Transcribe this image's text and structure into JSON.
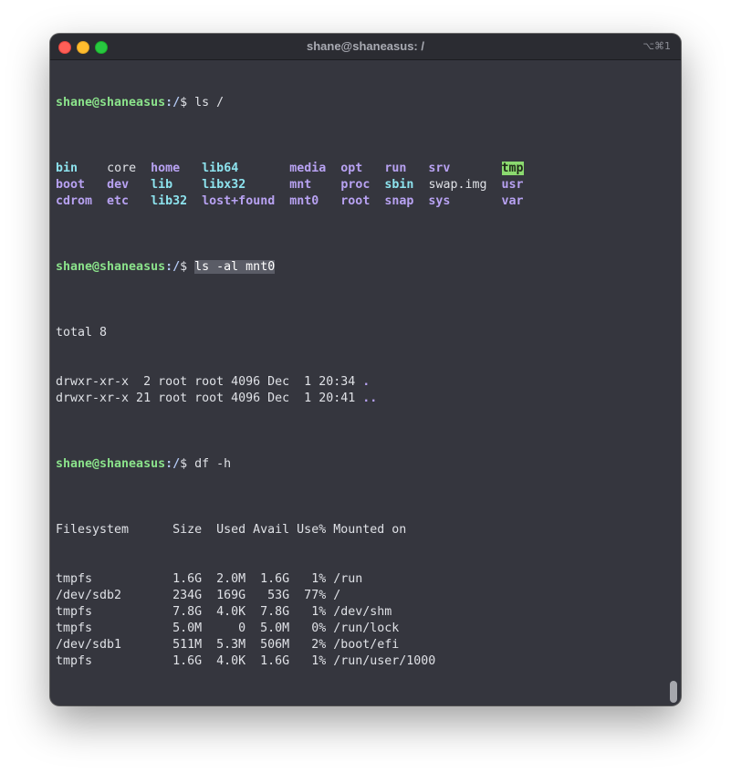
{
  "window": {
    "title": "shane@shaneasus: /",
    "shortcut": "⌥⌘1"
  },
  "prompt": {
    "user_host": "shane@shaneasus",
    "path": ":/",
    "symbol": "$"
  },
  "commands": {
    "ls": " ls /",
    "ls_al_space": " ",
    "ls_al": "ls -al mnt0",
    "df": " df -h"
  },
  "ls_output": {
    "rows": [
      [
        {
          "name": "bin",
          "kind": "link"
        },
        {
          "name": "core",
          "kind": "file"
        },
        {
          "name": "home",
          "kind": "dir"
        },
        {
          "name": "lib64",
          "kind": "link"
        },
        {
          "name": "media",
          "kind": "dir"
        },
        {
          "name": "opt",
          "kind": "dir"
        },
        {
          "name": "run",
          "kind": "dir"
        },
        {
          "name": "srv",
          "kind": "dir"
        },
        {
          "name": "tmp",
          "kind": "tmp"
        }
      ],
      [
        {
          "name": "boot",
          "kind": "dir"
        },
        {
          "name": "dev",
          "kind": "dir"
        },
        {
          "name": "lib",
          "kind": "link"
        },
        {
          "name": "libx32",
          "kind": "link"
        },
        {
          "name": "mnt",
          "kind": "dir"
        },
        {
          "name": "proc",
          "kind": "dir"
        },
        {
          "name": "sbin",
          "kind": "link"
        },
        {
          "name": "swap.img",
          "kind": "file"
        },
        {
          "name": "usr",
          "kind": "dir"
        }
      ],
      [
        {
          "name": "cdrom",
          "kind": "dir"
        },
        {
          "name": "etc",
          "kind": "dir"
        },
        {
          "name": "lib32",
          "kind": "link"
        },
        {
          "name": "lost+found",
          "kind": "dir"
        },
        {
          "name": "mnt0",
          "kind": "dir"
        },
        {
          "name": "root",
          "kind": "dir"
        },
        {
          "name": "snap",
          "kind": "dir"
        },
        {
          "name": "sys",
          "kind": "dir"
        },
        {
          "name": "var",
          "kind": "dir"
        }
      ]
    ]
  },
  "ls_al_output": {
    "total": "total 8",
    "rows": [
      {
        "meta": "drwxr-xr-x  2 root root 4096 Dec  1 20:34 ",
        "name": "."
      },
      {
        "meta": "drwxr-xr-x 21 root root 4096 Dec  1 20:41 ",
        "name": ".."
      }
    ]
  },
  "df_output": {
    "header": "Filesystem      Size  Used Avail Use% Mounted on",
    "rows": [
      "tmpfs           1.6G  2.0M  1.6G   1% /run",
      "/dev/sdb2       234G  169G   53G  77% /",
      "tmpfs           7.8G  4.0K  7.8G   1% /dev/shm",
      "tmpfs           5.0M     0  5.0M   0% /run/lock",
      "/dev/sdb1       511M  5.3M  506M   2% /boot/efi",
      "tmpfs           1.6G  4.0K  1.6G   1% /run/user/1000"
    ]
  },
  "final_prompt_space": " ",
  "colors": {
    "background": "#35363e",
    "prompt": "#8be38b",
    "path": "#b3c8f3",
    "directory": "#b8a2f2",
    "symlink": "#8de3ee",
    "tmp_highlight": "#8bd96f"
  }
}
